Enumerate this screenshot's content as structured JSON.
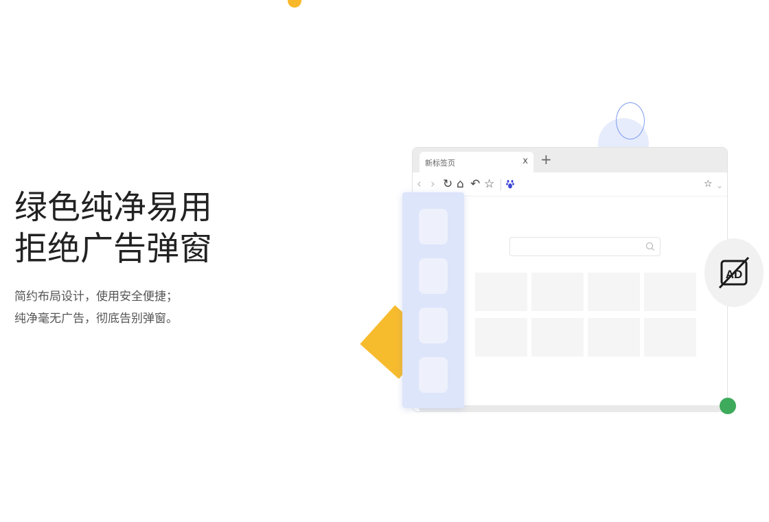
{
  "headline": {
    "line1": "绿色纯净易用",
    "line2": "拒绝广告弹窗"
  },
  "subtext": {
    "line1": "简约布局设计，使用安全便捷；",
    "line2": "纯净毫无广告，彻底告别弹窗。"
  },
  "browser": {
    "tab_title": "新标签页",
    "tab_close": "x",
    "new_tab": "+",
    "nav_icons": {
      "back": "back-icon",
      "forward": "forward-icon",
      "reload": "reload-icon",
      "home": "home-icon",
      "undo": "undo-icon",
      "favorite": "star-icon",
      "baidu": "baidu-paw-icon",
      "bookmark": "star-icon",
      "menu": "chevron-down-icon"
    },
    "search_icon": "search-icon",
    "tiles_count_note": ""
  },
  "badge": {
    "icon": "ad-block-icon",
    "text": "AD"
  },
  "colors": {
    "yellow": "#f7bb2e",
    "green": "#3eaa5b",
    "blue_light": "#dde5fb",
    "blue_ring": "#7d9cf0",
    "paw_blue": "#3b45d6"
  }
}
